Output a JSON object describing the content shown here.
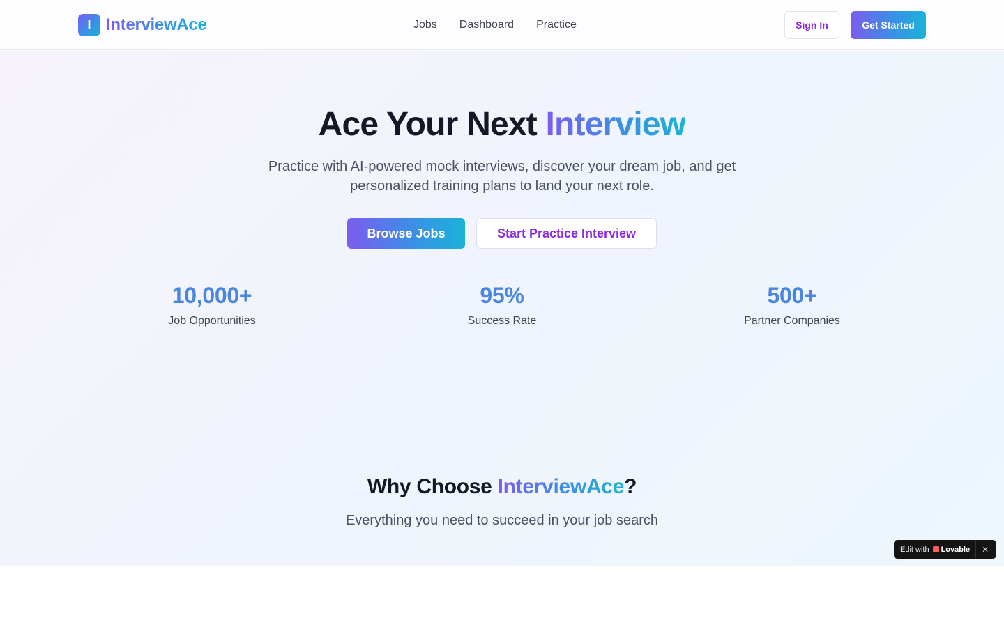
{
  "header": {
    "logo_letter": "I",
    "logo_text": "InterviewAce",
    "nav": [
      {
        "label": "Jobs"
      },
      {
        "label": "Dashboard"
      },
      {
        "label": "Practice"
      }
    ],
    "sign_in_label": "Sign In",
    "get_started_label": "Get Started"
  },
  "hero": {
    "title_plain": "Ace Your Next ",
    "title_highlight": "Interview",
    "subtitle": "Practice with AI-powered mock interviews, discover your dream job, and get personalized training plans to land your next role.",
    "browse_jobs_label": "Browse Jobs",
    "practice_label": "Start Practice Interview",
    "stats": [
      {
        "value": "10,000+",
        "label": "Job Opportunities"
      },
      {
        "value": "95%",
        "label": "Success Rate"
      },
      {
        "value": "500+",
        "label": "Partner Companies"
      }
    ]
  },
  "why": {
    "title_before": "Why Choose ",
    "title_highlight": "InterviewAce",
    "title_after": "?",
    "subtitle": "Everything you need to succeed in your job search"
  },
  "badge": {
    "edit_label": "Edit with",
    "brand_label": "Lovable",
    "close_glyph": "✕"
  },
  "colors": {
    "brand_gradient_start": "#7c5cf0",
    "brand_gradient_mid": "#3b8fe6",
    "brand_gradient_end": "#1ab3d8",
    "accent_purple": "#8a2be2",
    "stat_blue": "#4a86e0",
    "heading": "#141826"
  }
}
